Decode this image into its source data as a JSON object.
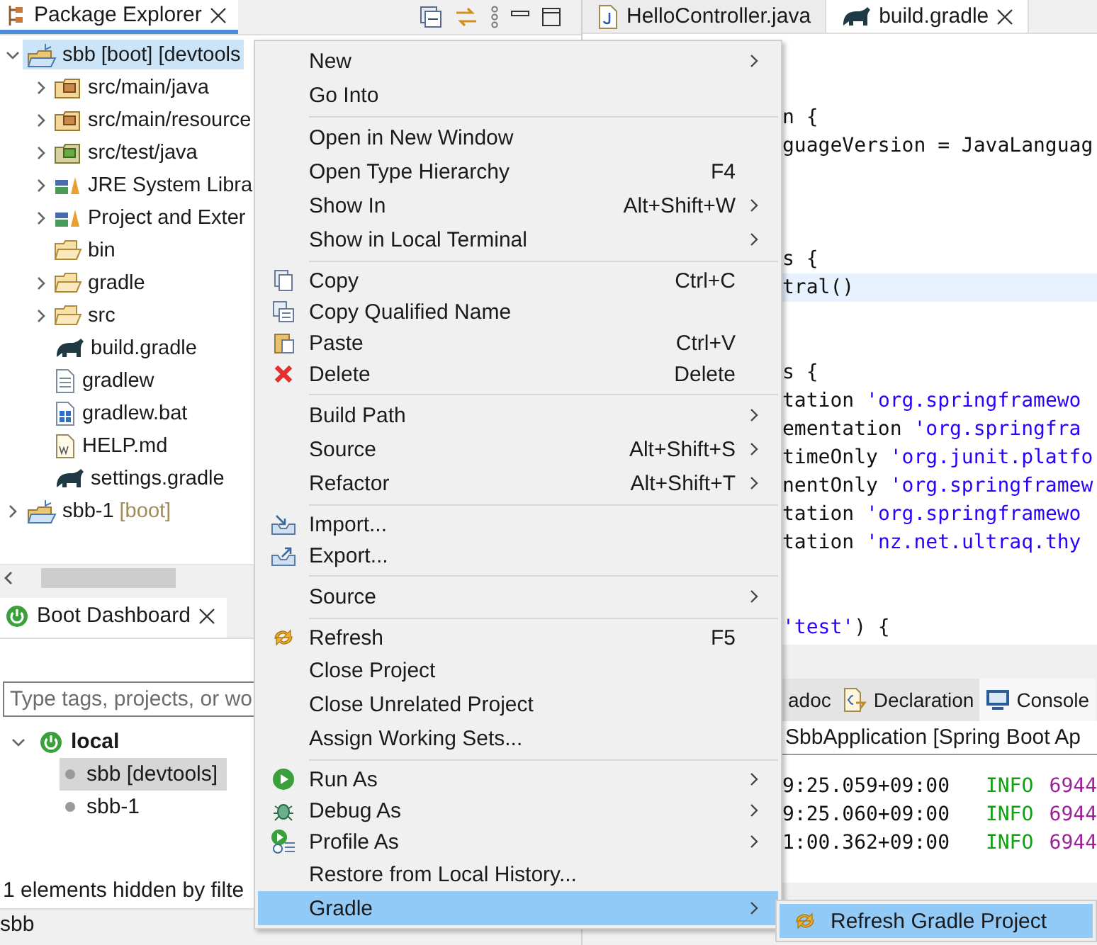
{
  "package_explorer": {
    "tab": {
      "label": "Package Explorer",
      "selected": true
    },
    "tree": [
      {
        "label": "sbb [boot] [devtools",
        "kind": "project",
        "expanded": true,
        "selected": true,
        "children": [
          {
            "label": "src/main/java",
            "kind": "source",
            "expanded": false,
            "selected": false
          },
          {
            "label": "src/main/resource",
            "kind": "source",
            "expanded": false,
            "selected": false
          },
          {
            "label": "src/test/java",
            "kind": "test",
            "expanded": false,
            "selected": false
          },
          {
            "label": "JRE System Libra",
            "kind": "library",
            "expanded": false,
            "selected": false
          },
          {
            "label": "Project and Exter",
            "kind": "library",
            "expanded": false,
            "selected": false
          },
          {
            "label": "bin",
            "kind": "folder",
            "selected": false
          },
          {
            "label": "gradle",
            "kind": "folder",
            "expanded": false,
            "selected": false
          },
          {
            "label": "src",
            "kind": "folder",
            "expanded": false,
            "selected": false
          },
          {
            "label": "build.gradle",
            "kind": "gradle",
            "selected": false
          },
          {
            "label": "gradlew",
            "kind": "text",
            "selected": false
          },
          {
            "label": "gradlew.bat",
            "kind": "bat",
            "selected": false
          },
          {
            "label": "HELP.md",
            "kind": "md",
            "selected": false
          },
          {
            "label": "settings.gradle",
            "kind": "gradle",
            "selected": false
          }
        ]
      },
      {
        "label": "sbb-1",
        "decoration": "[boot]",
        "kind": "project",
        "expanded": false,
        "selected": false
      }
    ]
  },
  "boot_dashboard": {
    "tab": {
      "label": "Boot Dashboard",
      "selected": true
    },
    "filter": {
      "placeholder": "Type tags, projects, or wo"
    },
    "tree": [
      {
        "label": "local",
        "expanded": true,
        "children": [
          {
            "label": "sbb [devtools]",
            "selected": true
          },
          {
            "label": "sbb-1",
            "selected": false
          }
        ]
      }
    ],
    "footer": "1 elements hidden by filte"
  },
  "status_bar": "sbb",
  "editor": {
    "tabs": [
      {
        "label": "HelloController.java",
        "kind": "java",
        "selected": false
      },
      {
        "label": "build.gradle",
        "kind": "gradle",
        "selected": true
      }
    ],
    "lines": [
      {
        "kind": "blank"
      },
      {
        "kind": "blank"
      },
      {
        "kind": "code",
        "highlighted": false,
        "segments": [
          {
            "text": "n {",
            "kind": "plain"
          }
        ]
      },
      {
        "kind": "code",
        "highlighted": false,
        "segments": [
          {
            "text": "guageVersion = JavaLanguag",
            "kind": "plain"
          }
        ]
      },
      {
        "kind": "blank"
      },
      {
        "kind": "blank"
      },
      {
        "kind": "blank"
      },
      {
        "kind": "code",
        "highlighted": false,
        "segments": [
          {
            "text": "s {",
            "kind": "plain"
          }
        ]
      },
      {
        "kind": "code",
        "highlighted": true,
        "segments": [
          {
            "text": "tral()",
            "kind": "plain"
          }
        ]
      },
      {
        "kind": "blank"
      },
      {
        "kind": "blank"
      },
      {
        "kind": "code",
        "highlighted": false,
        "segments": [
          {
            "text": "s {",
            "kind": "plain"
          }
        ]
      },
      {
        "kind": "code",
        "highlighted": false,
        "segments": [
          {
            "text": "tation ",
            "kind": "plain"
          },
          {
            "text": "'org.springframewo",
            "kind": "string"
          }
        ]
      },
      {
        "kind": "code",
        "highlighted": false,
        "segments": [
          {
            "text": "ementation ",
            "kind": "plain"
          },
          {
            "text": "'org.springfra",
            "kind": "string"
          }
        ]
      },
      {
        "kind": "code",
        "highlighted": false,
        "segments": [
          {
            "text": "timeOnly ",
            "kind": "plain"
          },
          {
            "text": "'org.junit.platfo",
            "kind": "string"
          }
        ]
      },
      {
        "kind": "code",
        "highlighted": false,
        "segments": [
          {
            "text": "nentOnly ",
            "kind": "plain"
          },
          {
            "text": "'org.springframew",
            "kind": "string"
          }
        ]
      },
      {
        "kind": "code",
        "highlighted": false,
        "segments": [
          {
            "text": "tation ",
            "kind": "plain"
          },
          {
            "text": "'org.springframewo",
            "kind": "string"
          }
        ]
      },
      {
        "kind": "code",
        "highlighted": false,
        "segments": [
          {
            "text": "tation ",
            "kind": "plain"
          },
          {
            "text": "'nz.net.ultraq.thy",
            "kind": "string"
          }
        ]
      },
      {
        "kind": "blank"
      },
      {
        "kind": "blank"
      },
      {
        "kind": "code",
        "highlighted": false,
        "segments": [
          {
            "text": "'test'",
            "kind": "string"
          },
          {
            "text": ") {",
            "kind": "plain"
          }
        ]
      }
    ]
  },
  "bottom_panel": {
    "tabs": [
      {
        "label": "adoc",
        "kind": "plain",
        "selected": false
      },
      {
        "label": "Declaration",
        "kind": "declaration",
        "selected": false
      },
      {
        "label": "Console",
        "kind": "console",
        "selected": true
      }
    ],
    "console_title": "SbbApplication [Spring Boot Ap",
    "log": [
      {
        "time": "9:25.059+09:00",
        "severity": "INFO",
        "pid": "6944"
      },
      {
        "time": "9:25.060+09:00",
        "severity": "INFO",
        "pid": "6944"
      },
      {
        "time": "1:00.362+09:00",
        "severity": "INFO",
        "pid": "6944"
      }
    ]
  },
  "context_menu": {
    "items": [
      {
        "kind": "item",
        "label": "New",
        "submenu": true,
        "selected": false
      },
      {
        "kind": "item",
        "label": "Go Into",
        "submenu": false,
        "selected": false
      },
      {
        "kind": "separator"
      },
      {
        "kind": "item",
        "label": "Open in New Window",
        "submenu": false,
        "selected": false
      },
      {
        "kind": "item",
        "label": "Open Type Hierarchy",
        "shortcut": "F4",
        "submenu": false,
        "selected": false
      },
      {
        "kind": "item",
        "label": "Show In",
        "shortcut": "Alt+Shift+W",
        "submenu": true,
        "selected": false
      },
      {
        "kind": "item",
        "label": "Show in Local Terminal",
        "submenu": true,
        "selected": false
      },
      {
        "kind": "separator"
      },
      {
        "kind": "copy",
        "label": "Copy",
        "shortcut": "Ctrl+C",
        "submenu": false,
        "selected": false
      },
      {
        "kind": "copyname",
        "label": "Copy Qualified Name",
        "submenu": false,
        "selected": false
      },
      {
        "kind": "paste",
        "label": "Paste",
        "shortcut": "Ctrl+V",
        "submenu": false,
        "selected": false
      },
      {
        "kind": "delete",
        "label": "Delete",
        "shortcut": "Delete",
        "submenu": false,
        "selected": false
      },
      {
        "kind": "separator"
      },
      {
        "kind": "item",
        "label": "Build Path",
        "submenu": true,
        "selected": false
      },
      {
        "kind": "item",
        "label": "Source",
        "shortcut": "Alt+Shift+S",
        "submenu": true,
        "selected": false
      },
      {
        "kind": "item",
        "label": "Refactor",
        "shortcut": "Alt+Shift+T",
        "submenu": true,
        "selected": false
      },
      {
        "kind": "separator"
      },
      {
        "kind": "import",
        "label": "Import...",
        "submenu": false,
        "selected": false
      },
      {
        "kind": "export",
        "label": "Export...",
        "submenu": false,
        "selected": false
      },
      {
        "kind": "separator"
      },
      {
        "kind": "item",
        "label": "Source",
        "submenu": true,
        "selected": false
      },
      {
        "kind": "separator"
      },
      {
        "kind": "refresh",
        "label": "Refresh",
        "shortcut": "F5",
        "submenu": false,
        "selected": false
      },
      {
        "kind": "item",
        "label": "Close Project",
        "submenu": false,
        "selected": false
      },
      {
        "kind": "item",
        "label": "Close Unrelated Project",
        "submenu": false,
        "selected": false
      },
      {
        "kind": "item",
        "label": "Assign Working Sets...",
        "submenu": false,
        "selected": false
      },
      {
        "kind": "separator"
      },
      {
        "kind": "run",
        "label": "Run As",
        "submenu": true,
        "selected": false
      },
      {
        "kind": "debug",
        "label": "Debug As",
        "submenu": true,
        "selected": false
      },
      {
        "kind": "profile",
        "label": "Profile As",
        "submenu": true,
        "selected": false
      },
      {
        "kind": "item",
        "label": "Restore from Local History...",
        "submenu": false,
        "selected": false
      },
      {
        "kind": "item",
        "label": "Gradle",
        "submenu": true,
        "selected": true
      }
    ]
  },
  "submenu": {
    "items": [
      {
        "label": "Refresh Gradle Project",
        "kind": "refresh",
        "selected": true
      }
    ]
  }
}
